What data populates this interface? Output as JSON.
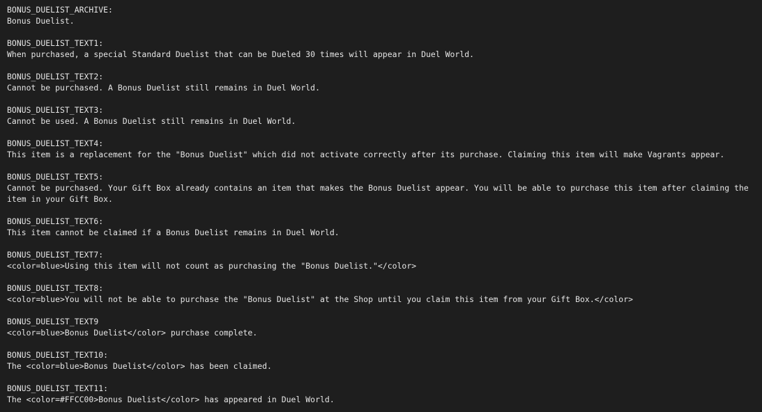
{
  "colors": {
    "background": "#1e1e1e",
    "text": "#e6e6e6"
  },
  "entries": [
    {
      "key": "BONUS_DUELIST_ARCHIVE:",
      "value": "Bonus Duelist."
    },
    {
      "key": "BONUS_DUELIST_TEXT1:",
      "value": "When purchased, a special Standard Duelist that can be Dueled 30 times will appear in Duel World."
    },
    {
      "key": "BONUS_DUELIST_TEXT2:",
      "value": "Cannot be purchased. A Bonus Duelist still remains in Duel World."
    },
    {
      "key": "BONUS_DUELIST_TEXT3:",
      "value": "Cannot be used. A Bonus Duelist still remains in Duel World."
    },
    {
      "key": "BONUS_DUELIST_TEXT4:",
      "value": "This item is a replacement for the \"Bonus Duelist\" which did not activate correctly after its purchase. Claiming this item will make Vagrants appear."
    },
    {
      "key": "BONUS_DUELIST_TEXT5:",
      "value": "Cannot be purchased. Your Gift Box already contains an item that makes the Bonus Duelist appear. You will be able to purchase this item after claiming the item in your Gift Box."
    },
    {
      "key": "BONUS_DUELIST_TEXT6:",
      "value": "This item cannot be claimed if a Bonus Duelist remains in Duel World."
    },
    {
      "key": "BONUS_DUELIST_TEXT7:",
      "value": "<color=blue>Using this item will not count as purchasing the \"Bonus Duelist.\"</color>"
    },
    {
      "key": "BONUS_DUELIST_TEXT8:",
      "value": "<color=blue>You will not be able to purchase the \"Bonus Duelist\" at the Shop until you claim this item from your Gift Box.</color>"
    },
    {
      "key": "BONUS_DUELIST_TEXT9",
      "value": "<color=blue>Bonus Duelist</color> purchase complete."
    },
    {
      "key": "BONUS_DUELIST_TEXT10:",
      "value": "The <color=blue>Bonus Duelist</color> has been claimed."
    },
    {
      "key": "BONUS_DUELIST_TEXT11:",
      "value": "The <color=#FFCC00>Bonus Duelist</color> has appeared in Duel World."
    }
  ]
}
